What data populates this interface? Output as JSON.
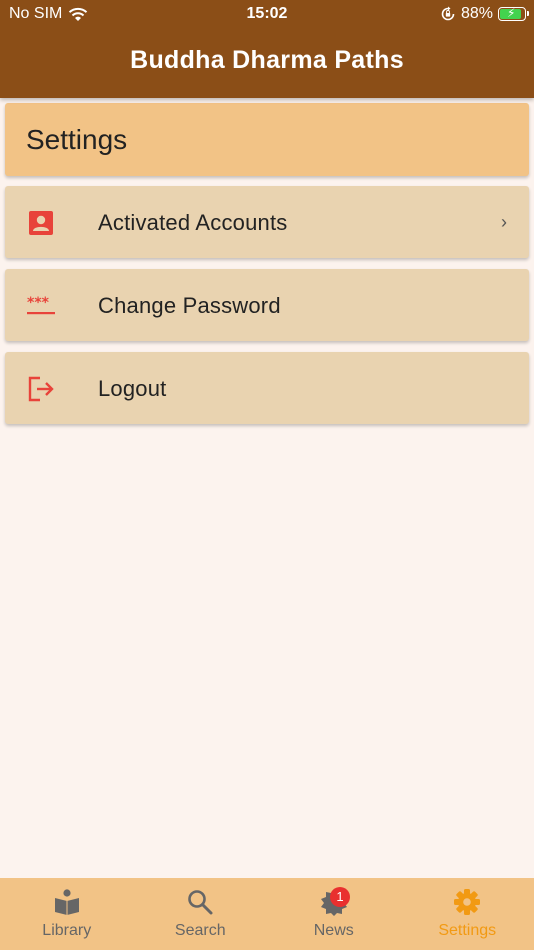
{
  "status_bar": {
    "carrier": "No SIM",
    "time": "15:02",
    "battery_percent": "88%",
    "battery_level": 0.88,
    "icons": [
      "wifi-icon",
      "orientation-lock-icon",
      "battery-charging-icon"
    ]
  },
  "header": {
    "title": "Buddha Dharma Paths",
    "color": "#8B4E17"
  },
  "settings": {
    "title": "Settings",
    "items": [
      {
        "label": "Activated Accounts",
        "icon": "account-box-icon",
        "has_chevron": true
      },
      {
        "label": "Change Password",
        "icon": "password-icon",
        "has_chevron": false
      },
      {
        "label": "Logout",
        "icon": "logout-icon",
        "has_chevron": false
      }
    ],
    "icon_color": "#E8433A"
  },
  "tab_bar": {
    "tabs": [
      {
        "label": "Library",
        "icon": "book-reader-icon",
        "active": false
      },
      {
        "label": "Search",
        "icon": "search-icon",
        "active": false
      },
      {
        "label": "News",
        "icon": "news-badge-icon",
        "active": false,
        "badge": "1"
      },
      {
        "label": "Settings",
        "icon": "gear-icon",
        "active": true
      }
    ],
    "active_color": "#F29A13",
    "inactive_color": "#666666"
  }
}
